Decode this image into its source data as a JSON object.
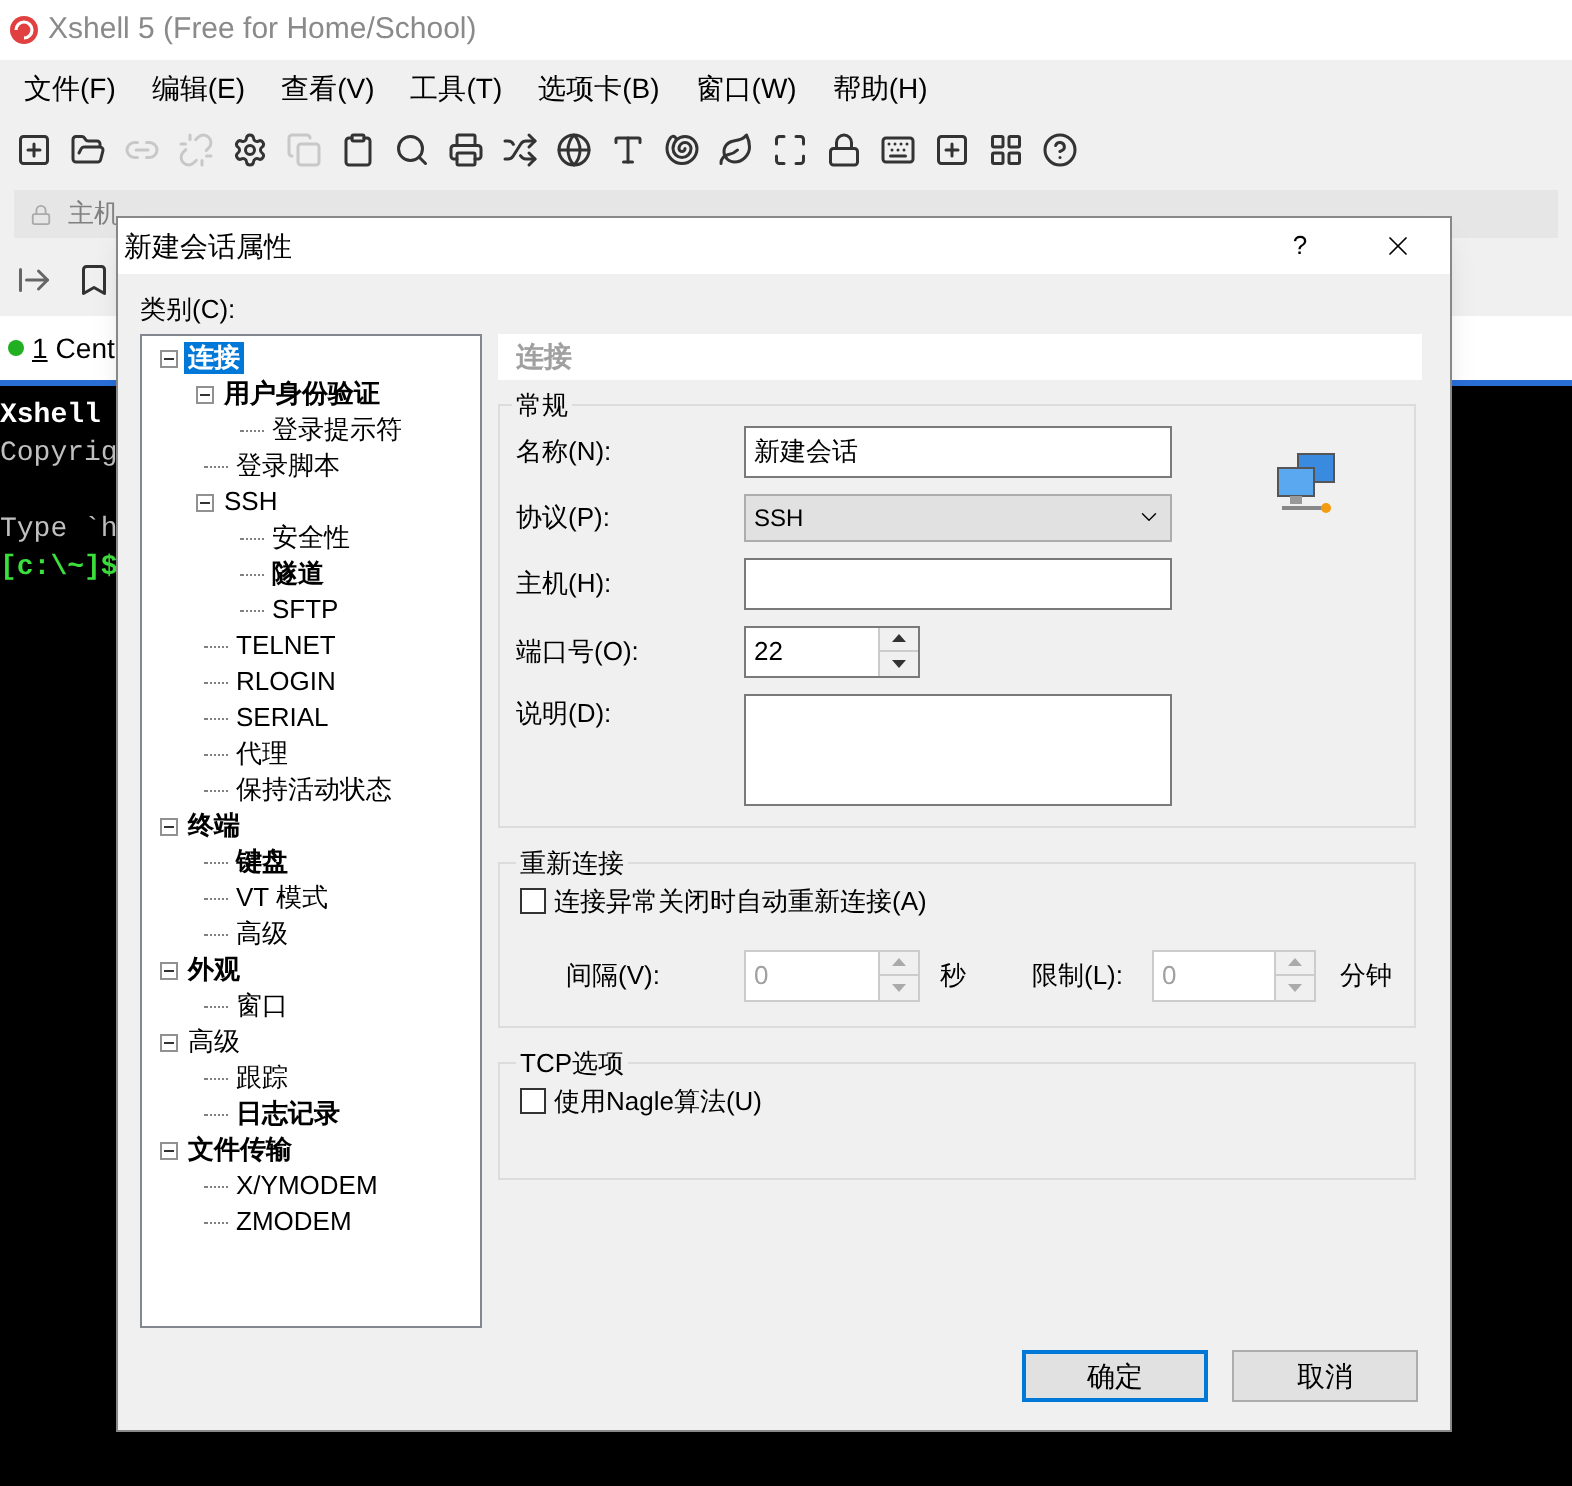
{
  "window": {
    "title": "Xshell 5 (Free for Home/School)"
  },
  "menu": [
    "文件(F)",
    "编辑(E)",
    "查看(V)",
    "工具(T)",
    "选项卡(B)",
    "窗口(W)",
    "帮助(H)"
  ],
  "address": {
    "placeholder": "主机"
  },
  "session_tab": {
    "number": "1",
    "label": "Cent",
    "connected": true
  },
  "terminal": [
    {
      "text": "Xshell",
      "kind": "bold"
    },
    {
      "text": "Copyrig",
      "kind": "plain"
    },
    {
      "text": "Type `h",
      "kind": "spaced"
    },
    {
      "text": "[c:\\~]$",
      "kind": "prompt"
    }
  ],
  "dialog": {
    "title": "新建会话属性",
    "help": "?",
    "category_label": "类别(C):",
    "tree": [
      {
        "label": "连接",
        "bold": true,
        "selected": true,
        "expanded": true,
        "children": [
          {
            "label": "用户身份验证",
            "bold": true,
            "selected": false,
            "expanded": true,
            "children": [
              {
                "label": "登录提示符",
                "bold": false,
                "selected": false
              }
            ]
          },
          {
            "label": "登录脚本",
            "bold": false,
            "selected": false
          },
          {
            "label": "SSH",
            "bold": false,
            "selected": false,
            "expanded": true,
            "children": [
              {
                "label": "安全性",
                "bold": false,
                "selected": false
              },
              {
                "label": "隧道",
                "bold": true,
                "selected": false
              },
              {
                "label": "SFTP",
                "bold": false,
                "selected": false
              }
            ]
          },
          {
            "label": "TELNET",
            "bold": false,
            "selected": false
          },
          {
            "label": "RLOGIN",
            "bold": false,
            "selected": false
          },
          {
            "label": "SERIAL",
            "bold": false,
            "selected": false
          },
          {
            "label": "代理",
            "bold": false,
            "selected": false
          },
          {
            "label": "保持活动状态",
            "bold": false,
            "selected": false
          }
        ]
      },
      {
        "label": "终端",
        "bold": true,
        "selected": false,
        "expanded": true,
        "children": [
          {
            "label": "键盘",
            "bold": true,
            "selected": false
          },
          {
            "label": "VT 模式",
            "bold": false,
            "selected": false
          },
          {
            "label": "高级",
            "bold": false,
            "selected": false
          }
        ]
      },
      {
        "label": "外观",
        "bold": true,
        "selected": false,
        "expanded": true,
        "children": [
          {
            "label": "窗口",
            "bold": false,
            "selected": false
          }
        ]
      },
      {
        "label": "高级",
        "bold": false,
        "selected": false,
        "expanded": true,
        "children": [
          {
            "label": "跟踪",
            "bold": false,
            "selected": false
          },
          {
            "label": "日志记录",
            "bold": true,
            "selected": false
          }
        ]
      },
      {
        "label": "文件传输",
        "bold": true,
        "selected": false,
        "expanded": true,
        "children": [
          {
            "label": "X/YMODEM",
            "bold": false,
            "selected": false
          },
          {
            "label": "ZMODEM",
            "bold": false,
            "selected": false
          }
        ]
      }
    ],
    "section_header": "连接",
    "general": {
      "title": "常规",
      "name_label": "名称(N):",
      "name_value": "新建会话",
      "protocol_label": "协议(P):",
      "protocol_value": "SSH",
      "host_label": "主机(H):",
      "port_label": "端口号(O):",
      "port_value": "22",
      "description_label": "说明(D):"
    },
    "reconnect": {
      "title": "重新连接",
      "checkbox": {
        "label": "连接异常关闭时自动重新连接(A)",
        "checked": false
      },
      "interval_label": "间隔(V):",
      "interval_value": "0",
      "interval_disabled": true,
      "interval_unit": "秒",
      "limit_label": "限制(L):",
      "limit_value": "0",
      "limit_disabled": true,
      "limit_unit": "分钟"
    },
    "tcp": {
      "title": "TCP选项",
      "checkbox": {
        "label": "使用Nagle算法(U)",
        "checked": false
      }
    },
    "buttons": [
      {
        "label": "确定",
        "default": true
      },
      {
        "label": "取消",
        "default": false
      }
    ]
  }
}
